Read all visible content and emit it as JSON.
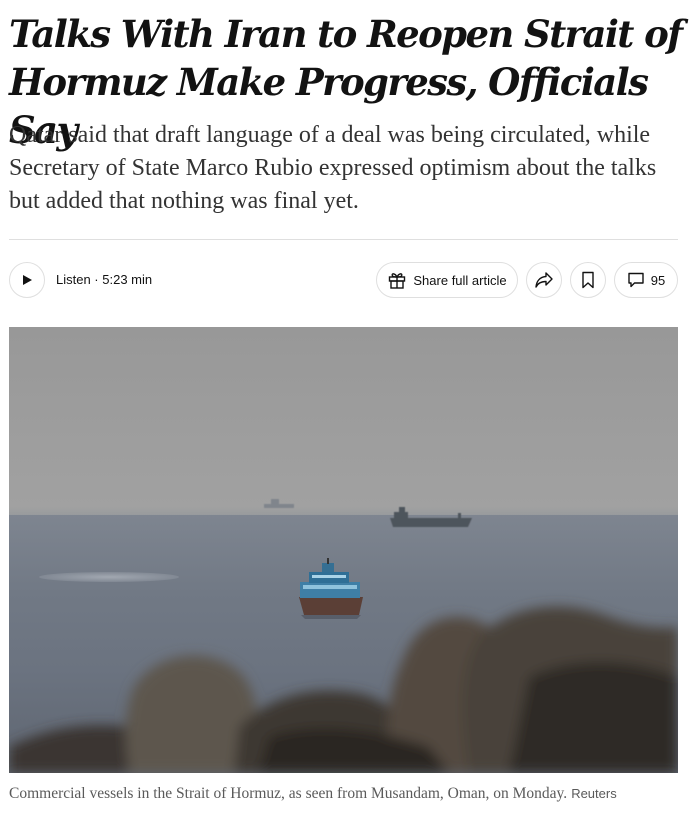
{
  "article": {
    "headline": "Talks With Iran to Reopen Strait of Hormuz Make Progress, Officials Say",
    "summary": "Qatar said that draft language of a deal was being circulated, while Secretary of State Marco Rubio expressed optimism about the talks but added that nothing was final yet."
  },
  "toolbar": {
    "listen_label": "Listen · 5:23 min",
    "share_label": "Share full article",
    "comment_count": "95",
    "icons": {
      "play": "play-icon",
      "share": "gift-icon",
      "forward": "share-arrow-icon",
      "save": "bookmark-icon",
      "comments": "comment-bubble-icon"
    }
  },
  "photo": {
    "caption": "Commercial vessels in the Strait of Hormuz, as seen from Musandam, Oman, on Monday.",
    "credit": "Reuters"
  },
  "colors": {
    "text": "#121212",
    "summary_text": "#333333",
    "caption_text": "#5a5a5a",
    "border": "#dfdfdf"
  }
}
